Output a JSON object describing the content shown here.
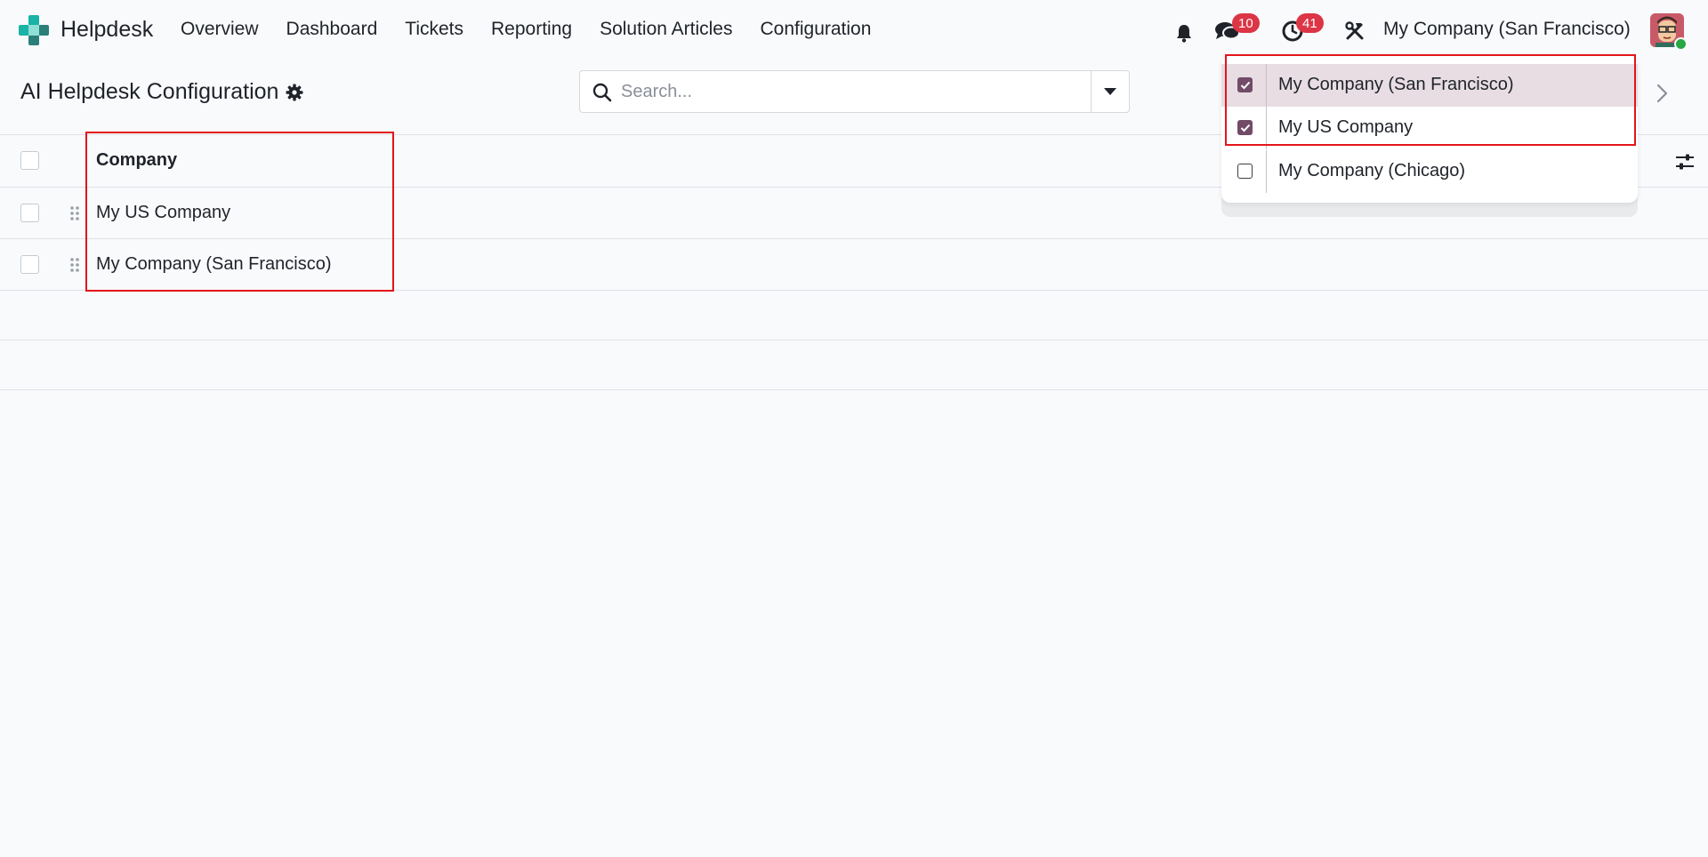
{
  "navbar": {
    "app_name": "Helpdesk",
    "menu": [
      "Overview",
      "Dashboard",
      "Tickets",
      "Reporting",
      "Solution Articles",
      "Configuration"
    ],
    "messages_count": "10",
    "activities_count": "41",
    "current_company": "My Company (San Francisco)"
  },
  "control_panel": {
    "title": "AI Helpdesk Configuration",
    "search_placeholder": "Search..."
  },
  "list": {
    "columns": [
      "Company"
    ],
    "rows": [
      "My US Company",
      "My Company (San Francisco)"
    ]
  },
  "company_dropdown": {
    "items": [
      {
        "label": "My Company (San Francisco)",
        "checked": true,
        "active": true
      },
      {
        "label": "My US Company",
        "checked": true,
        "active": false
      },
      {
        "label": "My Company (Chicago)",
        "checked": false,
        "active": false
      }
    ]
  },
  "colors": {
    "brand": "#714b67",
    "badge": "#dc3545",
    "highlight": "#e3151a",
    "logo_teal": "#1ab3a6"
  }
}
